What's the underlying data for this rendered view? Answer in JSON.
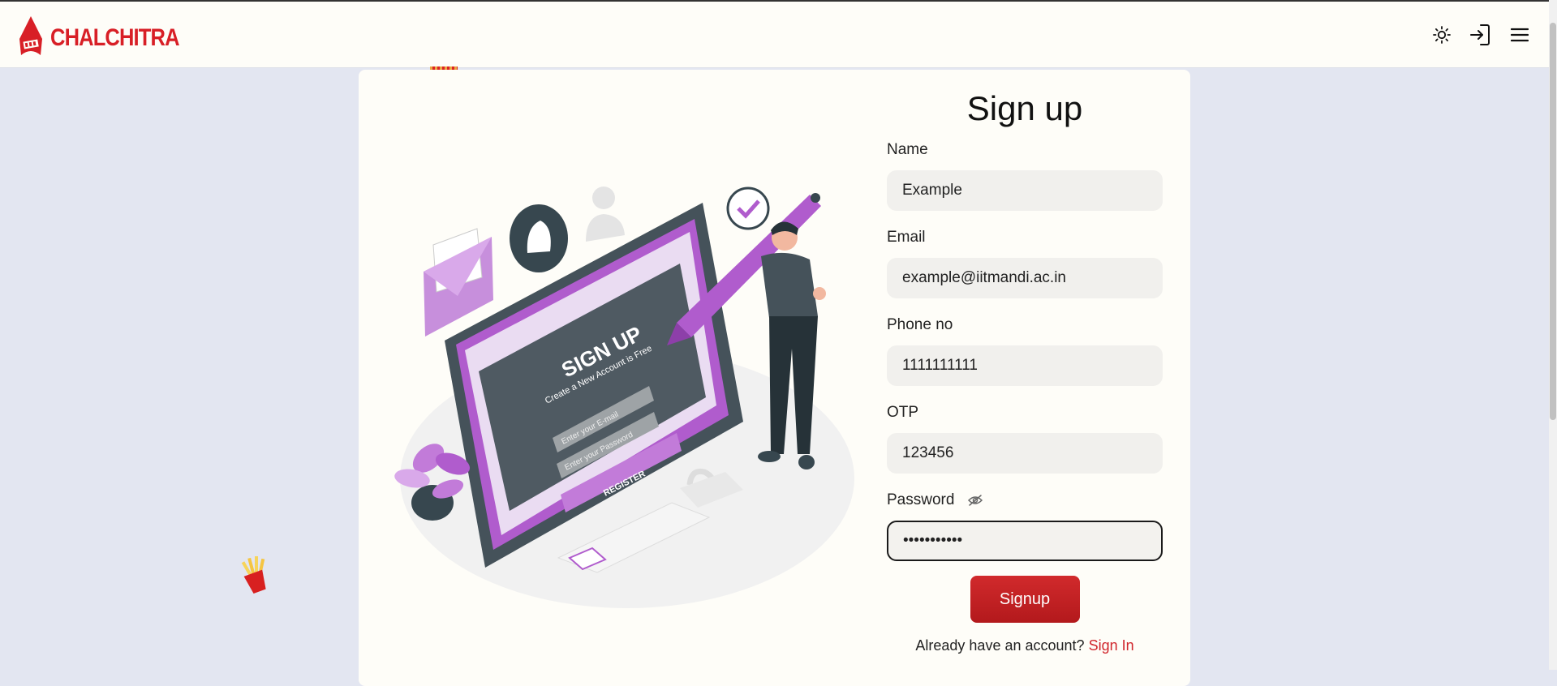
{
  "header": {
    "brand": "CHALCHITRA",
    "icons": [
      "sun-icon",
      "login-icon",
      "menu-icon"
    ]
  },
  "illustration": {
    "heading": "SIGN UP",
    "subheading": "Create a New Account is Free",
    "email_placeholder": "Enter your E-mail",
    "password_placeholder": "Enter your Password",
    "button": "REGISTER"
  },
  "form": {
    "title": "Sign up",
    "fields": [
      {
        "label": "Name",
        "value": "Example"
      },
      {
        "label": "Email",
        "value": "example@iitmandi.ac.in"
      },
      {
        "label": "Phone no",
        "value": "1111111111"
      },
      {
        "label": "OTP",
        "value": "123456"
      },
      {
        "label": "Password",
        "value": "•••••••••••"
      }
    ],
    "submit": "Signup",
    "footer_text": "Already have an account?",
    "footer_link": "Sign In"
  },
  "colors": {
    "brand": "#d81f26",
    "page_bg": "#e3e6f1",
    "card_bg": "#fefdf8",
    "accent_purple": "#b05ccd"
  }
}
